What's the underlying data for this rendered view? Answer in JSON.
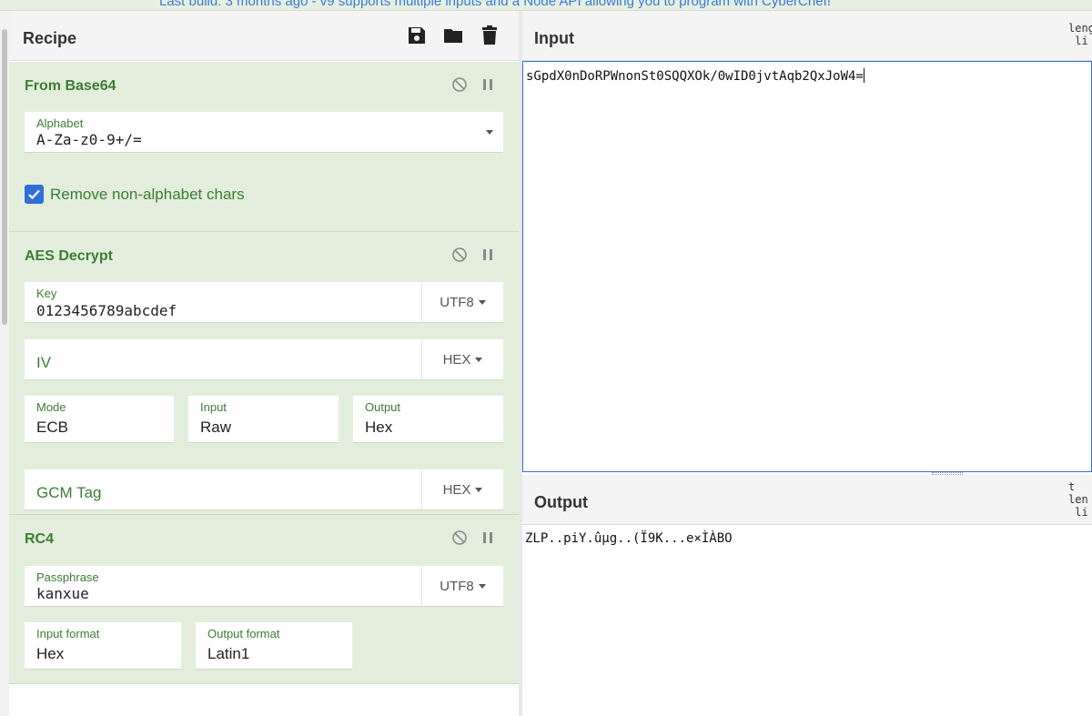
{
  "banner": {
    "text": "Last build: 3 months ago - v9 supports multiple inputs and a Node API allowing you to program with CyberChef!"
  },
  "recipe": {
    "title": "Recipe",
    "icons": [
      "save-icon",
      "folder-icon",
      "trash-icon"
    ],
    "operations": {
      "from_base64": {
        "title": "From Base64",
        "alphabet_label": "Alphabet",
        "alphabet_value": "A-Za-z0-9+/=",
        "remove_label": "Remove non-alphabet chars",
        "remove_checked": true
      },
      "aes_decrypt": {
        "title": "AES Decrypt",
        "key_label": "Key",
        "key_value": "0123456789abcdef",
        "key_format": "UTF8",
        "iv_placeholder": "IV",
        "iv_format": "HEX",
        "mode_label": "Mode",
        "mode_value": "ECB",
        "input_label": "Input",
        "input_value": "Raw",
        "output_label": "Output",
        "output_value": "Hex",
        "gcm_placeholder": "GCM Tag",
        "gcm_format": "HEX"
      },
      "rc4": {
        "title": "RC4",
        "passphrase_label": "Passphrase",
        "passphrase_value": "kanxue",
        "passphrase_format": "UTF8",
        "input_format_label": "Input format",
        "input_format_value": "Hex",
        "output_format_label": "Output format",
        "output_format_value": "Latin1"
      }
    }
  },
  "input": {
    "title": "Input",
    "stats": "leng\n li",
    "value": "sGpdX0nDoRPWnonSt0SQQXOk/0wID0jvtAqb2QxJoW4="
  },
  "output": {
    "title": "Output",
    "stats": "t\nlen\n li",
    "value": "ZLP..piY.ûµg..(Ï9K...e×ÌÀBO"
  },
  "colors": {
    "accent": "#3d7c34",
    "op_bg": "#e2eedb",
    "checkbox": "#2e6fd8"
  }
}
